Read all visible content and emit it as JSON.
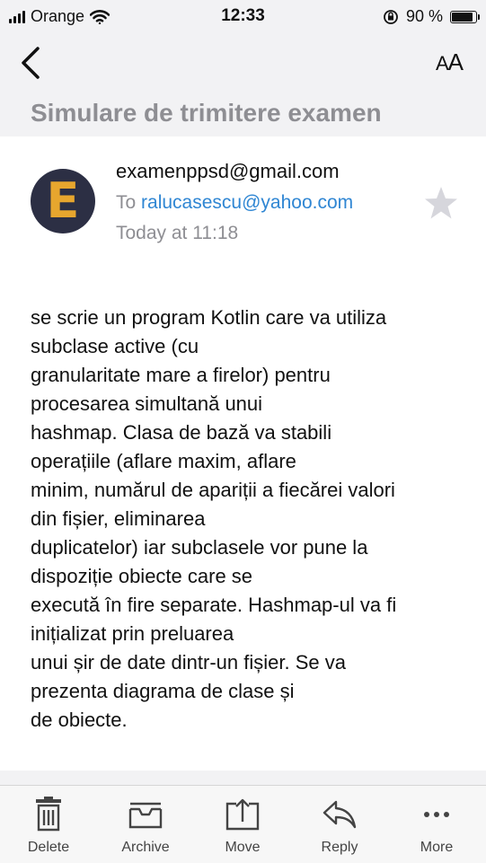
{
  "status": {
    "carrier": "Orange",
    "time": "12:33",
    "battery": "90 %",
    "battery_level": 0.9
  },
  "nav": {
    "aa_large": "A",
    "aa_small": "A"
  },
  "subject": "Simulare de trimitere examen",
  "message": {
    "avatar_letter": "E",
    "from": "examenppsd@gmail.com",
    "to_prefix": "To",
    "to_address": "ralucasescu@yahoo.com",
    "date": "Today at 11:18",
    "body_lines": [
      "se scrie un program Kotlin care va utiliza",
      "subclase active (cu",
      "granularitate mare a firelor) pentru",
      "procesarea simultană unui",
      "hashmap. Clasa de bază va stabili",
      "operațiile (aflare maxim, aflare",
      "minim, numărul de apariții a fiecărei valori",
      "din fișier, eliminarea",
      "duplicatelor) iar subclasele vor pune la",
      "dispoziție obiecte care se",
      "execută în fire separate. Hashmap-ul va fi",
      "inițializat prin preluarea",
      "unui șir de date dintr-un fișier. Se va",
      "prezenta diagrama de clase și",
      "de obiecte."
    ]
  },
  "toolbar": {
    "delete": "Delete",
    "archive": "Archive",
    "move": "Move",
    "reply": "Reply",
    "more": "More"
  },
  "colors": {
    "link": "#2f86d3",
    "muted": "#8e8e93",
    "avatar_bg": "#2c2f44",
    "avatar_letter": "#e7a62e"
  }
}
